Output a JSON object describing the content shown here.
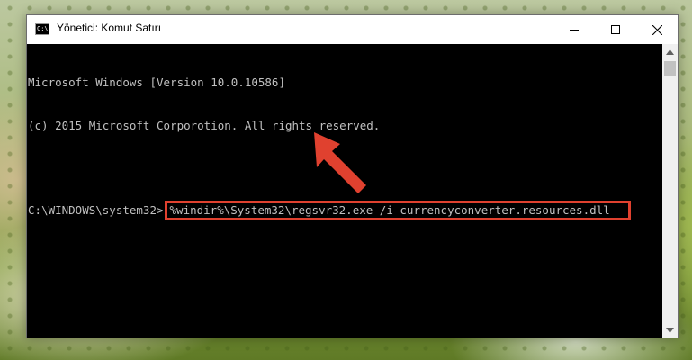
{
  "window": {
    "title": "Yönetici: Komut Satırı",
    "icon_text": "C:\\."
  },
  "console": {
    "lines": [
      "Microsoft Windows [Version 10.0.10586]",
      "(c) 2015 Microsoft Corporotion. All rights reserved."
    ],
    "prompt": "C:\\WINDOWS\\system32>",
    "command": "%windir%\\System32\\regsvr32.exe /i currencyconverter.resources.dll"
  },
  "colors": {
    "highlight": "#e0412f",
    "arrow": "#e0412f",
    "console_bg": "#000000",
    "console_text": "#c0c0c0"
  },
  "icons": {
    "minimize": "minimize-icon",
    "maximize": "maximize-icon",
    "close": "close-icon",
    "pointer": "red-arrow-icon"
  }
}
